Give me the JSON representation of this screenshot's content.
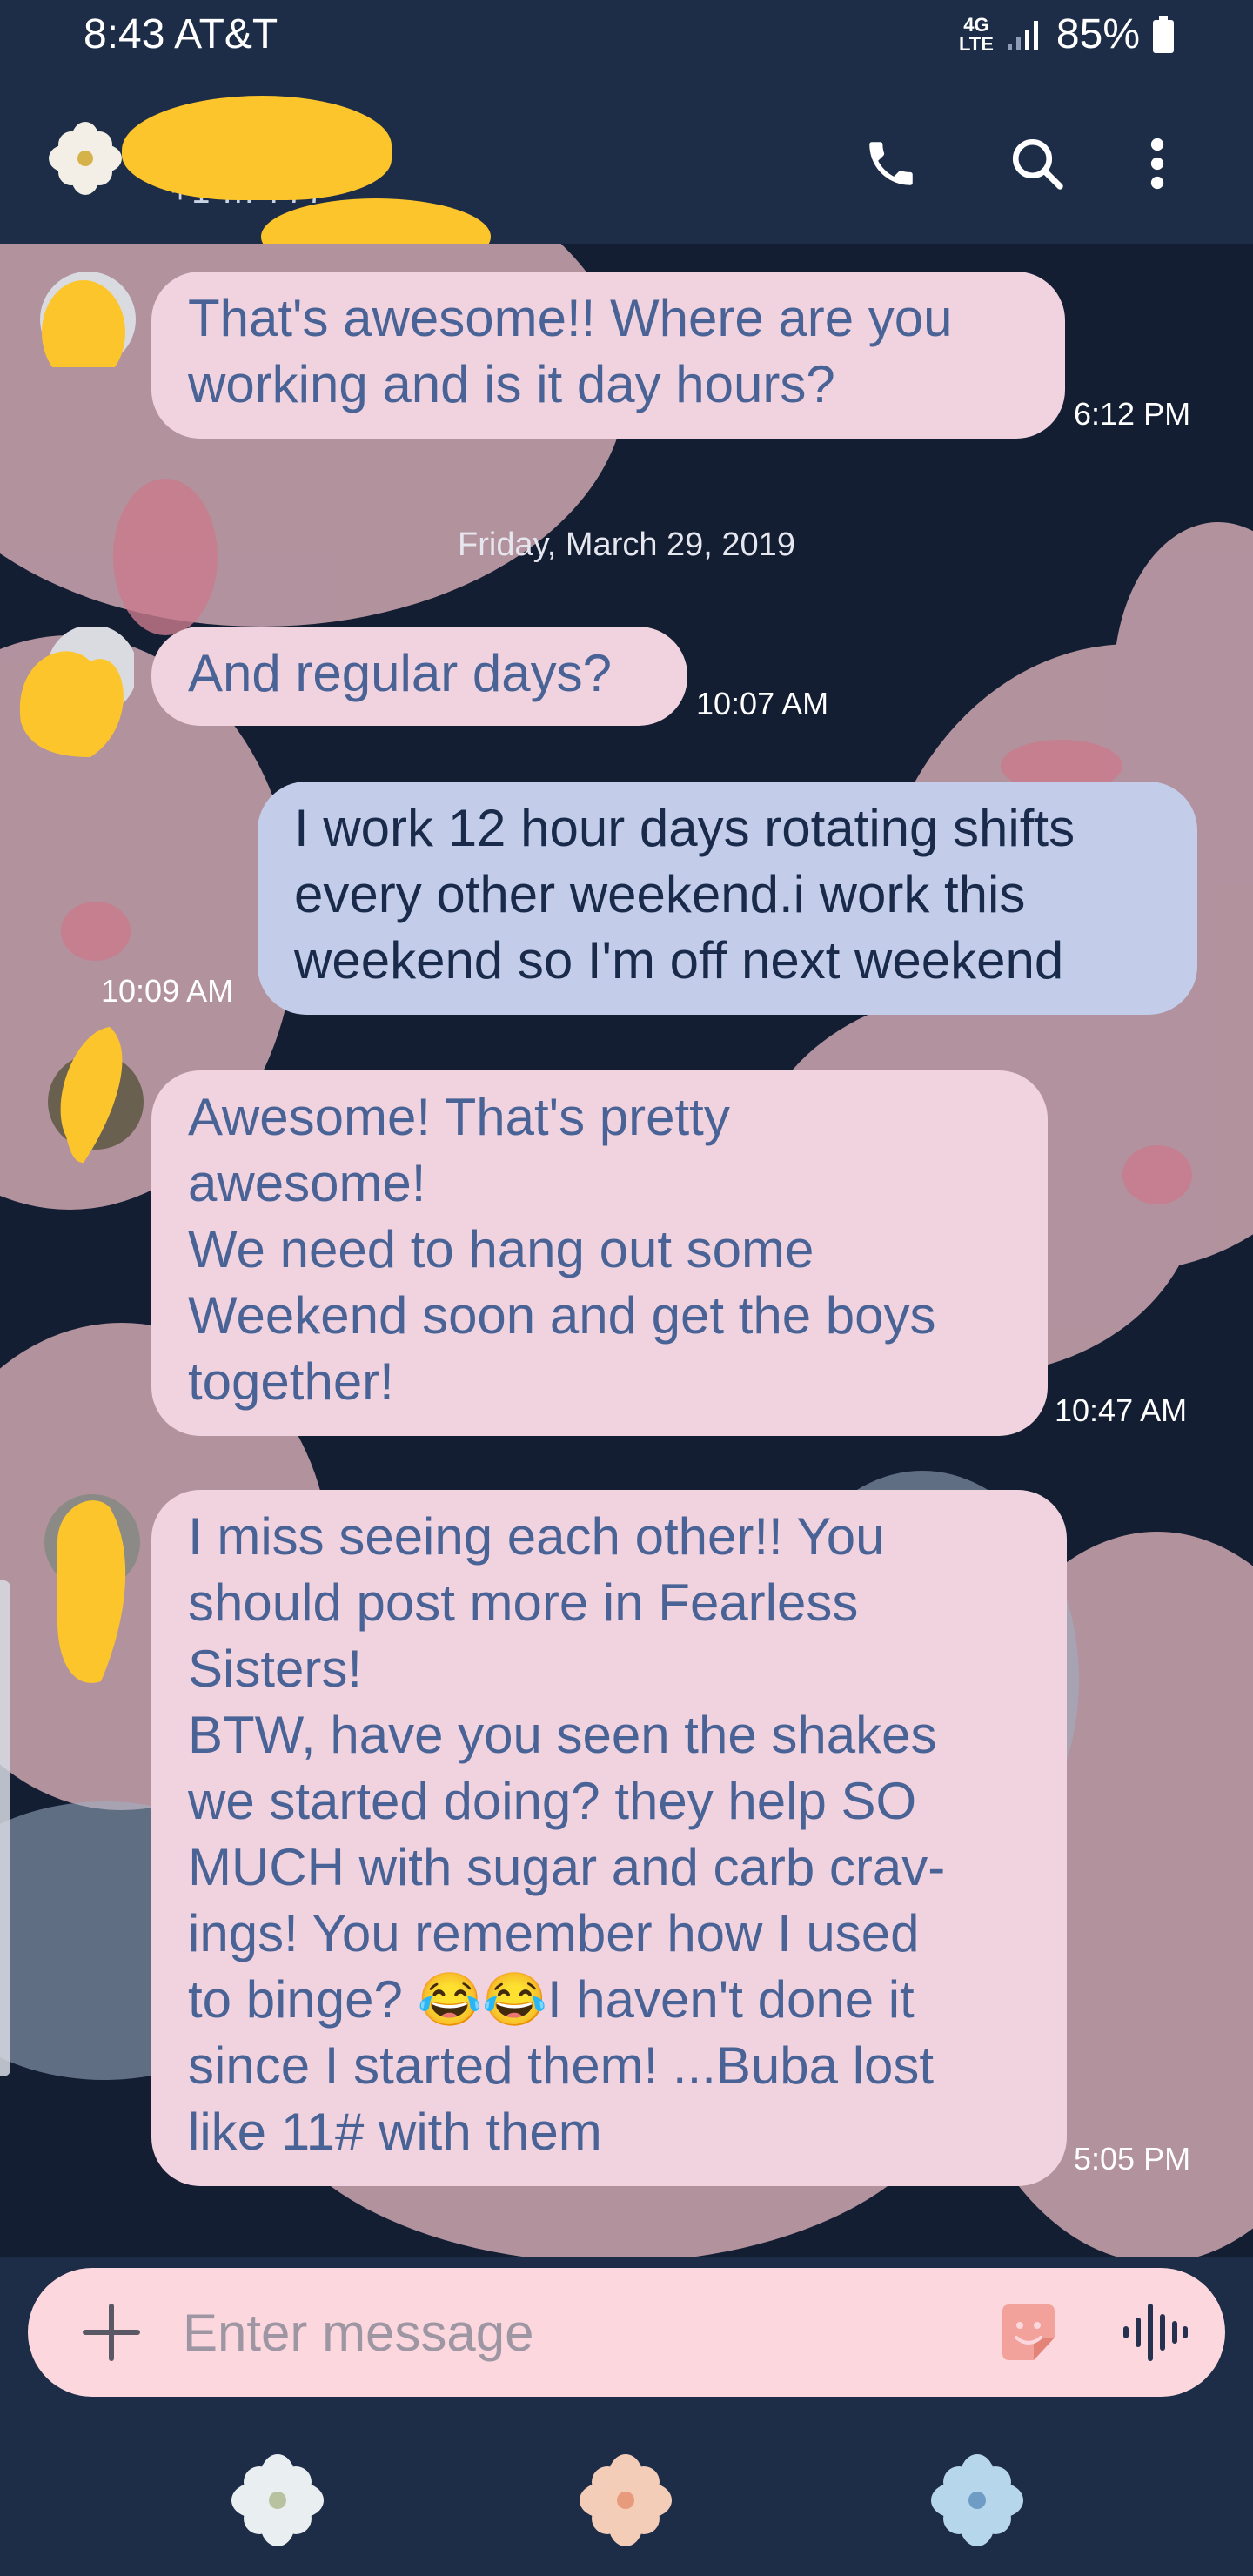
{
  "status_bar": {
    "time_carrier": "8:43 AT&T",
    "network": "4G LTE",
    "network_top": "4G",
    "network_bottom": "LTE",
    "battery": "85%",
    "icons": [
      "signal-icon",
      "battery-icon"
    ]
  },
  "header": {
    "contact_fragment": "+1 ... 777",
    "icons": [
      "flower-avatar-icon",
      "phone-icon",
      "search-icon",
      "more-vert-icon"
    ]
  },
  "messages": [
    {
      "direction": "incoming",
      "text": "That's awesome!! Where are you\nworking and is it day hours?",
      "time": "6:12 PM"
    },
    {
      "direction": "incoming",
      "text": "And regular days?",
      "time": "10:07 AM"
    },
    {
      "direction": "outgoing",
      "text": "I work 12 hour days rotating shifts\nevery other weekend.i work this\nweekend so I'm off next weekend",
      "time": "10:09 AM"
    },
    {
      "direction": "incoming",
      "text": "Awesome! That's pretty\nawesome!\nWe need to hang out some\nWeekend soon and get the boys\ntogether!",
      "time": "10:47 AM"
    },
    {
      "direction": "incoming",
      "text": "I miss seeing each other!! You\nshould post more in Fearless\nSisters!\nBTW, have you seen the shakes\nwe started doing? they help SO\nMUCH with sugar and carb crav-\nings! You remember how I used\nto binge? 😂😂I haven't done it\nsince I started them! ...Buba lost\nlike 11# with them",
      "time": "5:05 PM"
    }
  ],
  "date_separator": "Friday, March 29, 2019",
  "composer": {
    "placeholder": "Enter message",
    "icons": [
      "plus-icon",
      "sticker-icon",
      "voice-icon"
    ]
  },
  "bottom_nav": {
    "icons": [
      "nav-flower-white-icon",
      "nav-flower-peach-icon",
      "nav-flower-blue-icon"
    ]
  },
  "colors": {
    "background": "#1d2c47",
    "chat_background": "#131e33",
    "incoming_bubble": "#f0d3df",
    "incoming_text": "#4a6396",
    "outgoing_bubble": "#c3cdea",
    "outgoing_text": "#1a2a4a",
    "redaction": "#fdc52c",
    "composer": "#fcd8de"
  }
}
